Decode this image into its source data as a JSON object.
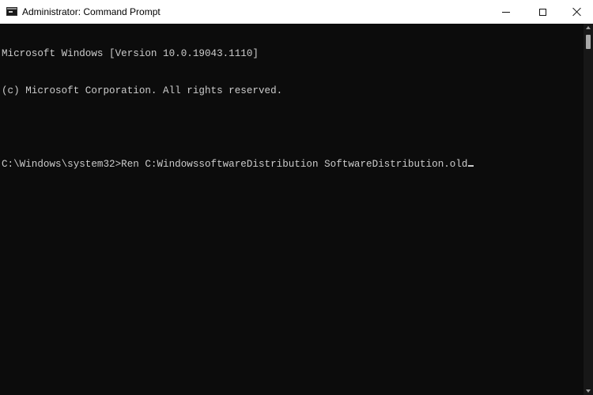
{
  "window": {
    "title": "Administrator: Command Prompt",
    "icon": "cmd-icon"
  },
  "controls": {
    "minimize_icon": "minimize-icon",
    "maximize_icon": "maximize-icon",
    "close_icon": "close-icon"
  },
  "console": {
    "lines": [
      "Microsoft Windows [Version 10.0.19043.1110]",
      "(c) Microsoft Corporation. All rights reserved.",
      "",
      "C:\\Windows\\system32>Ren C:WindowssoftwareDistribution SoftwareDistribution.old"
    ]
  },
  "colors": {
    "background": "#0c0c0c",
    "text": "#cccccc",
    "titlebar": "#ffffff"
  }
}
